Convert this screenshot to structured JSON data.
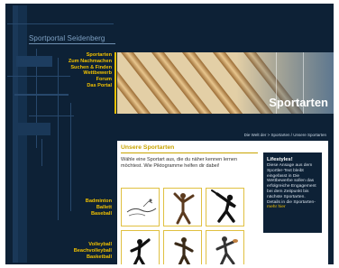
{
  "site": {
    "title": "Sportportal Seidenberg"
  },
  "nav": {
    "items": [
      "Sportarten",
      "Zum Nachmachen",
      "Suchen & Finden",
      "Wettbewerb",
      "Forum",
      "Das Portal"
    ]
  },
  "banner": {
    "title": "Sportarten"
  },
  "breadcrumb": "Die Welt der  >  Sportarten  /  Unsere Sportarten",
  "content": {
    "heading": "Unsere Sportarten",
    "intro": "Wähle eine Sportart aus, die du näher kennen lernen möchtest. Wie Piktogramme helfen dir dabei!"
  },
  "info": {
    "title": "Lifestyles!",
    "text": "Diese Ansage aus dem Sportler-Text bleibt eingefasst in Die Wettbewerbe sollen das erfolgreiche Engagement bei dem Zeitpunkt bis nächste Sportarten. Details in die Sportarten-",
    "link": "mehr hier"
  },
  "side_groups": {
    "group1": [
      "Badminton",
      "Ballett",
      "Baseball"
    ],
    "group2": [
      "Volleyball",
      "Beachvolleyball",
      "Basketball"
    ]
  },
  "tiles": [
    {
      "name": "ballett-pictogram"
    },
    {
      "name": "dance-pictogram"
    },
    {
      "name": "baseball-pictogram"
    },
    {
      "name": "basketball-pictogram"
    },
    {
      "name": "fitness-pictogram"
    },
    {
      "name": "rugby-pictogram"
    }
  ],
  "colors": {
    "navy": "#0d2136",
    "accent": "#f0c000",
    "banner": "#cfb58a"
  }
}
